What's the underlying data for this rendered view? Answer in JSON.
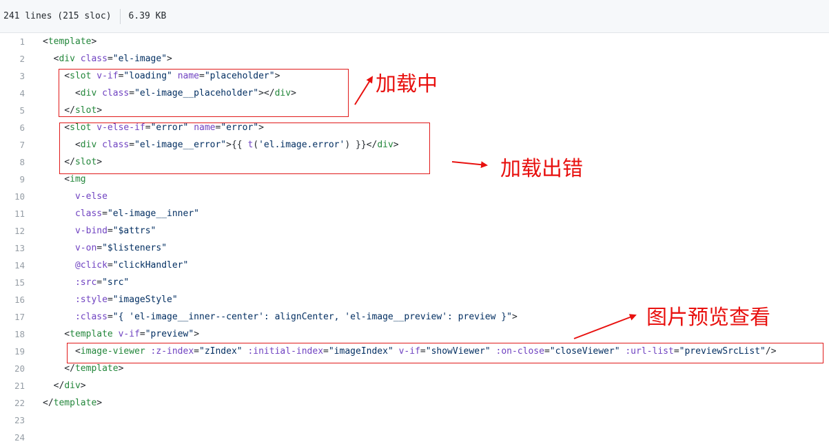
{
  "file_info": {
    "lines": "241 lines (215 sloc)",
    "size": "6.39 KB"
  },
  "code_lines": [
    {
      "n": "1",
      "tokens": [
        [
          "",
          "<"
        ],
        [
          "ent",
          "template"
        ],
        [
          "",
          ">"
        ]
      ]
    },
    {
      "n": "2",
      "tokens": [
        [
          "",
          "  <"
        ],
        [
          "ent",
          "div"
        ],
        [
          "",
          " "
        ],
        [
          "e",
          "class"
        ],
        [
          "",
          "="
        ],
        [
          "s",
          "\"el-image\""
        ],
        [
          "",
          ">"
        ]
      ]
    },
    {
      "n": "3",
      "tokens": [
        [
          "",
          "    <"
        ],
        [
          "ent",
          "slot"
        ],
        [
          "",
          " "
        ],
        [
          "e",
          "v-if"
        ],
        [
          "",
          "="
        ],
        [
          "s",
          "\"loading\""
        ],
        [
          "",
          " "
        ],
        [
          "e",
          "name"
        ],
        [
          "",
          "="
        ],
        [
          "s",
          "\"placeholder\""
        ],
        [
          "",
          ">"
        ]
      ]
    },
    {
      "n": "4",
      "tokens": [
        [
          "",
          "      <"
        ],
        [
          "ent",
          "div"
        ],
        [
          "",
          " "
        ],
        [
          "e",
          "class"
        ],
        [
          "",
          "="
        ],
        [
          "s",
          "\"el-image__placeholder\""
        ],
        [
          "",
          "></"
        ],
        [
          "ent",
          "div"
        ],
        [
          "",
          ">"
        ]
      ]
    },
    {
      "n": "5",
      "tokens": [
        [
          "",
          "    </"
        ],
        [
          "ent",
          "slot"
        ],
        [
          "",
          ">"
        ]
      ]
    },
    {
      "n": "6",
      "tokens": [
        [
          "",
          "    <"
        ],
        [
          "ent",
          "slot"
        ],
        [
          "",
          " "
        ],
        [
          "e",
          "v-else-if"
        ],
        [
          "",
          "="
        ],
        [
          "s",
          "\"error\""
        ],
        [
          "",
          " "
        ],
        [
          "e",
          "name"
        ],
        [
          "",
          "="
        ],
        [
          "s",
          "\"error\""
        ],
        [
          "",
          ">"
        ]
      ]
    },
    {
      "n": "7",
      "tokens": [
        [
          "",
          "      <"
        ],
        [
          "ent",
          "div"
        ],
        [
          "",
          " "
        ],
        [
          "e",
          "class"
        ],
        [
          "",
          "="
        ],
        [
          "s",
          "\"el-image__error\""
        ],
        [
          "",
          ">{{ "
        ],
        [
          "e",
          "t"
        ],
        [
          "",
          "("
        ],
        [
          "s",
          "'el.image.error'"
        ],
        [
          "",
          ") }}</"
        ],
        [
          "ent",
          "div"
        ],
        [
          "",
          ">"
        ]
      ]
    },
    {
      "n": "8",
      "tokens": [
        [
          "",
          "    </"
        ],
        [
          "ent",
          "slot"
        ],
        [
          "",
          ">"
        ]
      ]
    },
    {
      "n": "9",
      "tokens": [
        [
          "",
          "    <"
        ],
        [
          "ent",
          "img"
        ]
      ]
    },
    {
      "n": "10",
      "tokens": [
        [
          "",
          "      "
        ],
        [
          "e",
          "v-else"
        ]
      ]
    },
    {
      "n": "11",
      "tokens": [
        [
          "",
          "      "
        ],
        [
          "e",
          "class"
        ],
        [
          "",
          "="
        ],
        [
          "s",
          "\"el-image__inner\""
        ]
      ]
    },
    {
      "n": "12",
      "tokens": [
        [
          "",
          "      "
        ],
        [
          "e",
          "v-bind"
        ],
        [
          "",
          "="
        ],
        [
          "s",
          "\"$attrs\""
        ]
      ]
    },
    {
      "n": "13",
      "tokens": [
        [
          "",
          "      "
        ],
        [
          "e",
          "v-on"
        ],
        [
          "",
          "="
        ],
        [
          "s",
          "\"$listeners\""
        ]
      ]
    },
    {
      "n": "14",
      "tokens": [
        [
          "",
          "      "
        ],
        [
          "e",
          "@click"
        ],
        [
          "",
          "="
        ],
        [
          "s",
          "\"clickHandler\""
        ]
      ]
    },
    {
      "n": "15",
      "tokens": [
        [
          "",
          "      "
        ],
        [
          "e",
          ":src"
        ],
        [
          "",
          "="
        ],
        [
          "s",
          "\"src\""
        ]
      ]
    },
    {
      "n": "16",
      "tokens": [
        [
          "",
          "      "
        ],
        [
          "e",
          ":style"
        ],
        [
          "",
          "="
        ],
        [
          "s",
          "\"imageStyle\""
        ]
      ]
    },
    {
      "n": "17",
      "tokens": [
        [
          "",
          "      "
        ],
        [
          "e",
          ":class"
        ],
        [
          "",
          "="
        ],
        [
          "s",
          "\"{ 'el-image__inner--center': alignCenter, 'el-image__preview': preview }\""
        ],
        [
          "",
          ">"
        ]
      ]
    },
    {
      "n": "18",
      "tokens": [
        [
          "",
          "    <"
        ],
        [
          "ent",
          "template"
        ],
        [
          "",
          " "
        ],
        [
          "e",
          "v-if"
        ],
        [
          "",
          "="
        ],
        [
          "s",
          "\"preview\""
        ],
        [
          "",
          ">"
        ]
      ]
    },
    {
      "n": "19",
      "tokens": [
        [
          "",
          "      <"
        ],
        [
          "ent",
          "image-viewer"
        ],
        [
          "",
          " "
        ],
        [
          "e",
          ":z-index"
        ],
        [
          "",
          "="
        ],
        [
          "s",
          "\"zIndex\""
        ],
        [
          "",
          " "
        ],
        [
          "e",
          ":initial-index"
        ],
        [
          "",
          "="
        ],
        [
          "s",
          "\"imageIndex\""
        ],
        [
          "",
          " "
        ],
        [
          "e",
          "v-if"
        ],
        [
          "",
          "="
        ],
        [
          "s",
          "\"showViewer\""
        ],
        [
          "",
          " "
        ],
        [
          "e",
          ":on-close"
        ],
        [
          "",
          "="
        ],
        [
          "s",
          "\"closeViewer\""
        ],
        [
          "",
          " "
        ],
        [
          "e",
          ":url-list"
        ],
        [
          "",
          "="
        ],
        [
          "s",
          "\"previewSrcList\""
        ],
        [
          "",
          "/>"
        ]
      ]
    },
    {
      "n": "20",
      "tokens": [
        [
          "",
          "    </"
        ],
        [
          "ent",
          "template"
        ],
        [
          "",
          ">"
        ]
      ]
    },
    {
      "n": "21",
      "tokens": [
        [
          "",
          "  </"
        ],
        [
          "ent",
          "div"
        ],
        [
          "",
          ">"
        ]
      ]
    },
    {
      "n": "22",
      "tokens": [
        [
          "",
          "</"
        ],
        [
          "ent",
          "template"
        ],
        [
          "",
          ">"
        ]
      ]
    },
    {
      "n": "23",
      "tokens": []
    },
    {
      "n": "24",
      "tokens": []
    }
  ],
  "annotations": {
    "loading": "加载中",
    "error": "加载出错",
    "preview": "图片预览查看"
  },
  "colors": {
    "annotation": "#e8110f",
    "tag": "#22863a",
    "attr": "#6f42c1",
    "string": "#032f62"
  }
}
